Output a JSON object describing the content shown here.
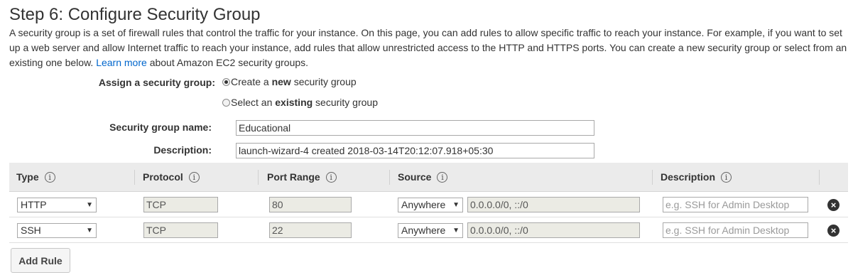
{
  "page": {
    "title": "Step 6: Configure Security Group",
    "intro_before_link": "A security group is a set of firewall rules that control the traffic for your instance. On this page, you can add rules to allow specific traffic to reach your instance. For example, if you want to set up a web server and allow Internet traffic to reach your instance, add rules that allow unrestricted access to the HTTP and HTTPS ports. You can create a new security group or select from an existing one below.",
    "learn_more": "Learn more",
    "intro_after_link": "about Amazon EC2 security groups."
  },
  "assign": {
    "label": "Assign a security group:",
    "option_new": {
      "prefix": "Create a ",
      "bold": "new",
      "suffix": " security group",
      "checked": true
    },
    "option_existing": {
      "prefix": "Select an ",
      "bold": "existing",
      "suffix": " security group",
      "checked": false
    }
  },
  "group_name": {
    "label": "Security group name:",
    "value": "Educational"
  },
  "description": {
    "label": "Description:",
    "value": "launch-wizard-4 created 2018-03-14T20:12:07.918+05:30"
  },
  "table": {
    "headers": {
      "type": "Type",
      "protocol": "Protocol",
      "port_range": "Port Range",
      "source": "Source",
      "description": "Description"
    },
    "info_glyph": "i",
    "rows": [
      {
        "type": "HTTP",
        "protocol": "TCP",
        "port": "80",
        "source_select": "Anywhere",
        "source_cidr": "0.0.0.0/0, ::/0",
        "desc_placeholder": "e.g. SSH for Admin Desktop"
      },
      {
        "type": "SSH",
        "protocol": "TCP",
        "port": "22",
        "source_select": "Anywhere",
        "source_cidr": "0.0.0.0/0, ::/0",
        "desc_placeholder": "e.g. SSH for Admin Desktop"
      }
    ]
  },
  "remove_glyph": "×",
  "dropdown_glyph": "▼",
  "add_rule_label": "Add Rule",
  "colors": {
    "link": "#0066cc",
    "header_bg": "#ebebeb",
    "readonly_bg": "#ebebe4"
  }
}
